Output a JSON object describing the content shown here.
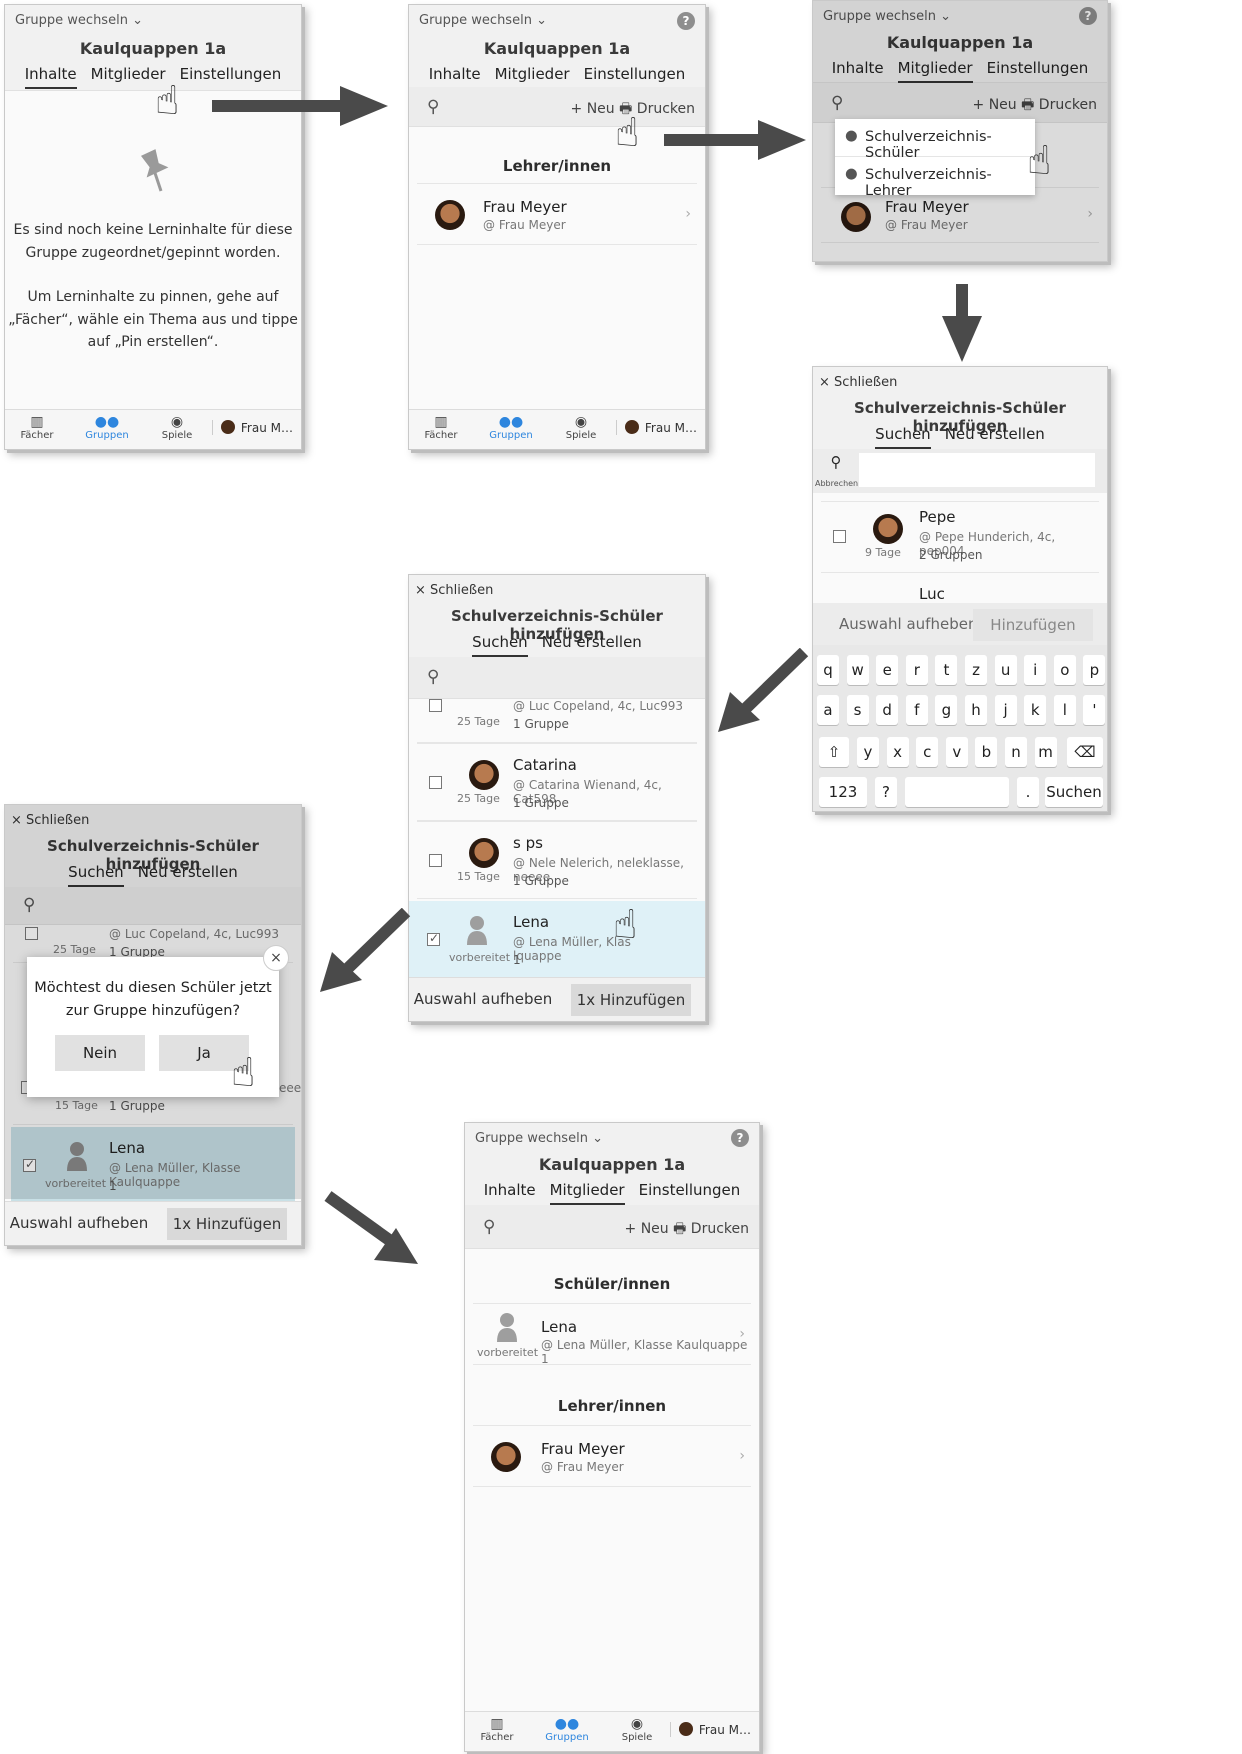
{
  "common": {
    "group_switch": "Gruppe wechseln ⌄",
    "group_name": "Kaulquappen 1a",
    "tab_contents": "Inhalte",
    "tab_members": "Mitglieder",
    "tab_settings": "Einstellungen",
    "help": "?",
    "new": "+ Neu",
    "print": "🖶 Drucken",
    "nav_subjects": "Fächer",
    "nav_groups": "Gruppen",
    "nav_games": "Spiele",
    "nav_user": "Frau M…",
    "teachers_heading": "Lehrer/innen",
    "students_heading": "Schüler/innen",
    "close": "× Schließen",
    "add_title": "Schulverzeichnis-Schüler hinzufügen",
    "tab_search": "Suchen",
    "tab_create": "Neu erstellen",
    "cancel": "Abbrechen",
    "deselect": "Auswahl aufheben",
    "add": "Hinzufügen",
    "add_one": "1x Hinzufügen"
  },
  "panel1": {
    "empty_line1": "Es sind noch keine Lerninhalte für diese",
    "empty_line2": "Gruppe zugeordnet/gepinnt worden.",
    "empty_line3": "Um Lerninhalte zu pinnen, gehe auf",
    "empty_line4": "„Fächer“, wähle ein Thema aus und tippe",
    "empty_line5": "auf „Pin erstellen“."
  },
  "teacher": {
    "name": "Frau Meyer",
    "handle": "@ Frau Meyer"
  },
  "panel3": {
    "menu_students": "Schulverzeichnis-Schüler",
    "menu_teachers": "Schulverzeichnis-Lehrer"
  },
  "panel4": {
    "pepe_name": "Pepe",
    "pepe_sub": "@ Pepe Hunderich, 4c, pep004",
    "pepe_groups": "2 Gruppen",
    "pepe_days": "9 Tage",
    "luc_name": "Luc",
    "kb_row1": [
      "q",
      "w",
      "e",
      "r",
      "t",
      "z",
      "u",
      "i",
      "o",
      "p"
    ],
    "kb_row2": [
      "a",
      "s",
      "d",
      "f",
      "g",
      "h",
      "j",
      "k",
      "l",
      "'"
    ],
    "kb_row3": [
      "y",
      "x",
      "c",
      "v",
      "b",
      "n",
      "m"
    ],
    "kb_123": "123",
    "kb_q": "?",
    "kb_dot": ".",
    "kb_search": "Suchen"
  },
  "panel5": {
    "luc_sub": "@ Luc Copeland, 4c, Luc993",
    "luc_groups": "1 Gruppe",
    "luc_days": "25 Tage",
    "cat_name": "Catarina",
    "cat_sub": "@ Catarina Wienand, 4c, Cat598",
    "cat_groups": "1 Gruppe",
    "cat_days": "25 Tage",
    "sps_name": "s ps",
    "sps_sub": "@ Nele Nelerich, neleklasse, neeee",
    "sps_groups": "1 Gruppe",
    "sps_days": "15 Tage",
    "lena_name": "Lena",
    "lena_sub": "@ Lena Müller, Klas",
    "lena_sub_tail": "lquappe",
    "lena_count": "1",
    "lena_status": "vorbereitet"
  },
  "panel6": {
    "question1": "Möchtest du diesen Schüler jetzt",
    "question2": "zur Gruppe hinzufügen?",
    "no": "Nein",
    "yes": "Ja",
    "close_x": "×",
    "luc_sub": "@ Luc Copeland, 4c, Luc993",
    "luc_groups": "1 Gruppe",
    "luc_days": "25 Tage",
    "partial_eee": "eee",
    "days15": "15 Tage",
    "groups1": "1 Gruppe",
    "lena_name": "Lena",
    "lena_sub": "@ Lena Müller, Klasse Kaulquappe",
    "lena_count": "1",
    "lena_status": "vorbereitet"
  },
  "panel7": {
    "lena_name": "Lena",
    "lena_sub": "@ Lena Müller, Klasse Kaulquappe 1",
    "lena_status": "vorbereitet"
  },
  "colors": {
    "accent": "#2e86de",
    "arrow": "#4a4a4a",
    "selected": "#dff1f7"
  }
}
